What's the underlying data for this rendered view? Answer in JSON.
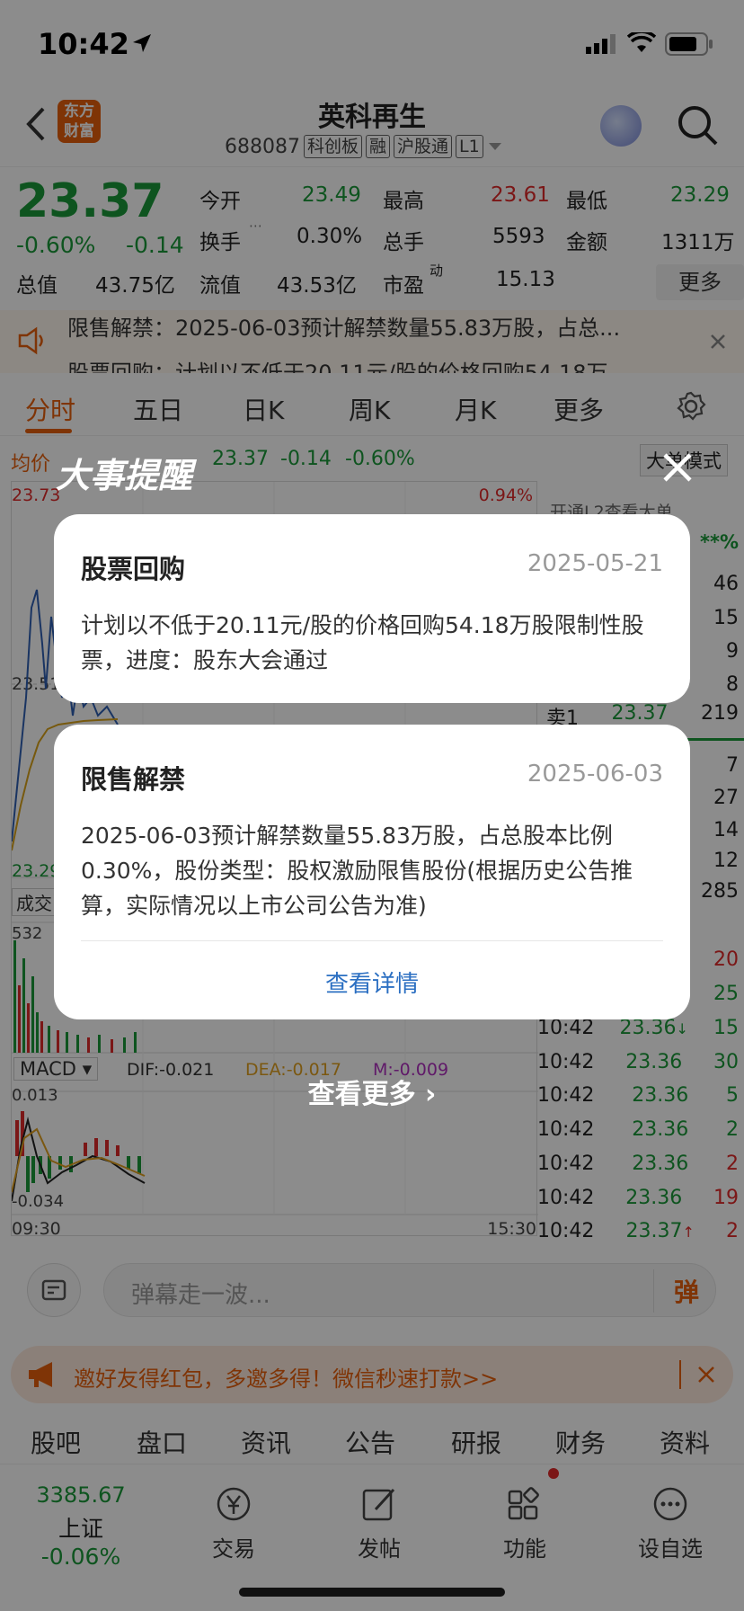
{
  "status_bar": {
    "time": "10:42"
  },
  "header": {
    "stock_name": "英科再生",
    "stock_code": "688087",
    "tags": [
      "科创板",
      "融",
      "沪股通",
      "L1"
    ],
    "logo_text": [
      "东方",
      "财富"
    ]
  },
  "quote": {
    "price": "23.37",
    "change_pct": "-0.60%",
    "change_abs": "-0.14",
    "open_label": "今开",
    "open": "23.49",
    "high_label": "最高",
    "high": "23.61",
    "low_label": "最低",
    "low": "23.29",
    "turnover_label": "换手",
    "turnover": "0.30%",
    "volume_label": "总手",
    "volume": "5593",
    "amount_label": "金额",
    "amount": "1311万",
    "mktcap_label": "总值",
    "mktcap": "43.75亿",
    "float_label": "流值",
    "float_cap": "43.53亿",
    "pe_label": "市盈",
    "pe_sup": "动",
    "pe": "15.13",
    "more_button": "更多"
  },
  "notice": {
    "lines": [
      "限售解禁：2025-06-03预计解禁数量55.83万股，占总...",
      "股票回购：计划以不低于20.11元/股的价格回购54.18万"
    ]
  },
  "chart_tabs": [
    "分时",
    "五日",
    "日K",
    "周K",
    "月K",
    "更多"
  ],
  "chart_info": {
    "avg_label": "均价",
    "last": "23.37",
    "chg": "-0.14",
    "pct": "-0.60%",
    "mode_btn": "大单模式",
    "top_price": "23.73",
    "top_pct": "0.94%",
    "mid_price": "23.51",
    "bottom_price": "23.29",
    "vol_label": "成交",
    "vol_max": "532",
    "macd_label": "MACD",
    "dif": "DIF:-0.021",
    "dea": "DEA:-0.017",
    "m": "M:-0.009",
    "macd_top": "0.013",
    "macd_bottom": "-0.034",
    "t_start": "09:30",
    "t_end": "15:30",
    "l2_hint": "开通L2查看大单",
    "pct_stub": "**%"
  },
  "order_book": {
    "upper_vols": [
      "46",
      "15",
      "9",
      "8"
    ],
    "sell1": {
      "label": "卖1",
      "price": "23.37",
      "vol": "219"
    },
    "lower_vols": [
      "7",
      "27",
      "14",
      "12",
      "285"
    ],
    "trade_vols": [
      "20",
      "25"
    ],
    "trades": [
      {
        "time": "10:42",
        "price": "23.36",
        "arrow": "↓",
        "vol": "15",
        "color": "green"
      },
      {
        "time": "10:42",
        "price": "23.36",
        "arrow": "",
        "vol": "30",
        "color": "green"
      },
      {
        "time": "10:42",
        "price": "23.36",
        "arrow": "",
        "vol": "5",
        "color": "green"
      },
      {
        "time": "10:42",
        "price": "23.36",
        "arrow": "",
        "vol": "2",
        "color": "green"
      },
      {
        "time": "10:42",
        "price": "23.36",
        "arrow": "",
        "vol": "2",
        "color": "red"
      },
      {
        "time": "10:42",
        "price": "23.36",
        "arrow": "",
        "vol": "19",
        "color": "red"
      },
      {
        "time": "10:42",
        "price": "23.37",
        "arrow": "↑",
        "vol": "2",
        "color": "red"
      }
    ]
  },
  "comment_bar": {
    "placeholder": "弹幕走一波...",
    "danmu_btn": "弹"
  },
  "ad": {
    "text": "邀好友得红包，多邀多得！微信秒速打款>>"
  },
  "sub_tabs": [
    "股吧",
    "盘口",
    "资讯",
    "公告",
    "研报",
    "财务",
    "资料"
  ],
  "bottom_nav": {
    "index_value": "3385.67",
    "index_name": "上证",
    "index_change": "-0.06%",
    "items": [
      "交易",
      "发帖",
      "功能",
      "设自选"
    ]
  },
  "overlay": {
    "title": "大事提醒",
    "cards": [
      {
        "title": "股票回购",
        "date": "2025-05-21",
        "body": "计划以不低于20.11元/股的价格回购54.18万股限制性股票，进度：股东大会通过"
      },
      {
        "title": "限售解禁",
        "date": "2025-06-03",
        "body": "2025-06-03预计解禁数量55.83万股，占总股本比例0.30%，股份类型：股权激励限售股份(根据历史公告推算，实际情况以上市公司公告为准)",
        "link": "查看详情"
      }
    ],
    "see_more": "查看更多"
  }
}
